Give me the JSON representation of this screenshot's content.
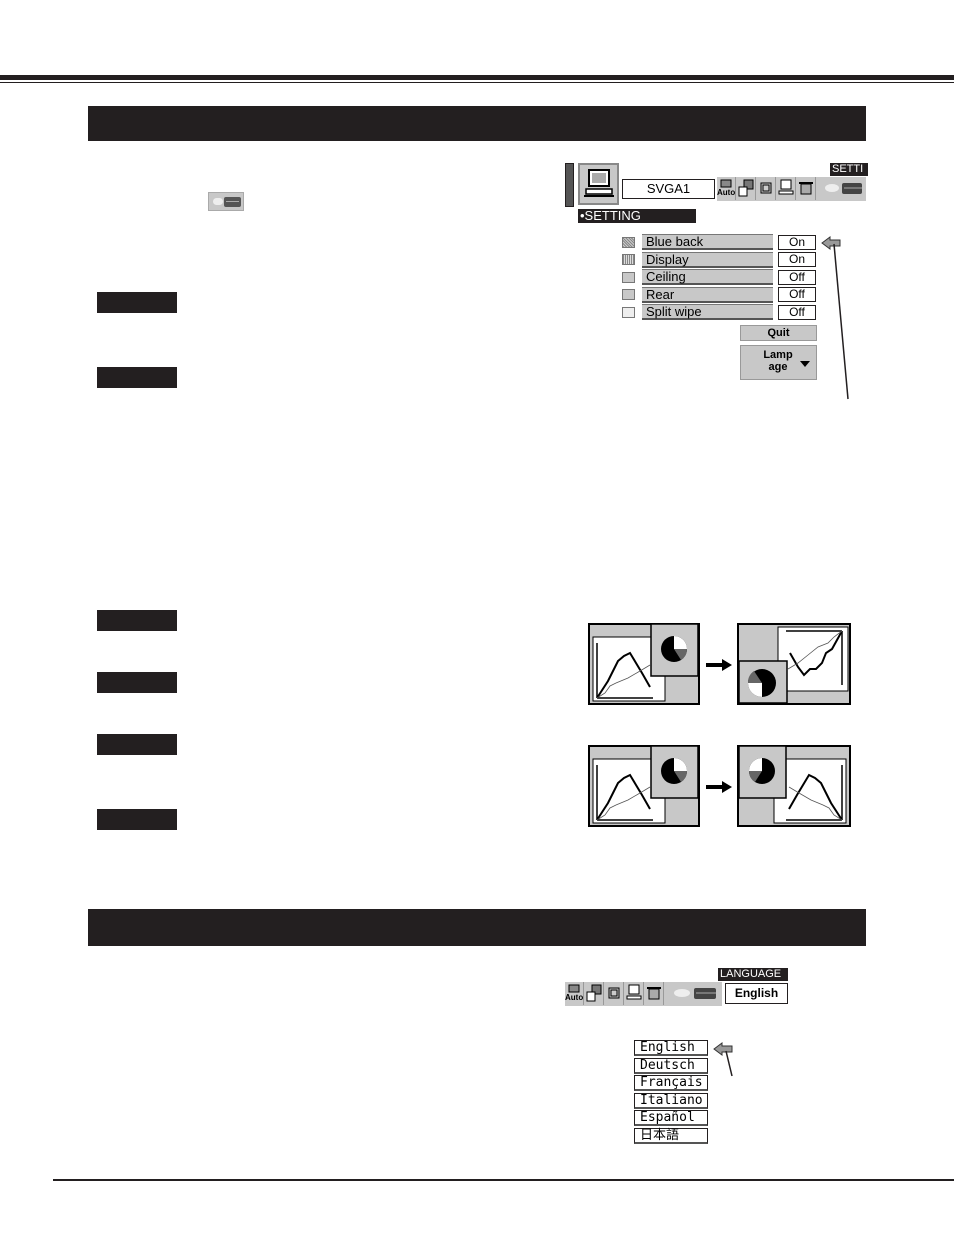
{
  "page": {
    "section_headers": [
      "",
      ""
    ],
    "labels": [
      "",
      "",
      "",
      "",
      "",
      ""
    ]
  },
  "setting_menu": {
    "source_field": "SVGA1",
    "toolbar_title": "SETTI",
    "toolbar_buttons": [
      {
        "icon": "auto-pc-adjust-icon",
        "label": "Auto"
      },
      {
        "icon": "image-select-icon",
        "label": ""
      },
      {
        "icon": "screen-position-icon",
        "label": ""
      },
      {
        "icon": "pc-system-icon",
        "label": ""
      },
      {
        "icon": "screen-icon",
        "label": ""
      },
      {
        "icon": "setting-lamp-icon",
        "label": ""
      }
    ],
    "section_label": "•SETTING",
    "items": [
      {
        "icon": "blue-back-icon",
        "label": "Blue back",
        "value": "On"
      },
      {
        "icon": "display-icon",
        "label": "Display",
        "value": "On"
      },
      {
        "icon": "ceiling-icon",
        "label": "Ceiling",
        "value": "Off"
      },
      {
        "icon": "rear-icon",
        "label": "Rear",
        "value": "Off"
      },
      {
        "icon": "split-wipe-icon",
        "label": "Split wipe",
        "value": "Off"
      }
    ],
    "quit_label": "Quit",
    "lamp_age_label": "Lamp age",
    "lamp_age_line1": "Lamp",
    "lamp_age_line2": "age",
    "pointer": "arrow-pointer-icon"
  },
  "diagrams": {
    "ceiling": {
      "caption": "",
      "description": "Image flipped vertically"
    },
    "rear": {
      "caption": "",
      "description": "Image flipped horizontally"
    }
  },
  "language_menu": {
    "toolbar_title": "LANGUAGE",
    "current": "English",
    "toolbar_buttons": [
      {
        "icon": "auto-pc-adjust-icon",
        "label": "Auto"
      },
      {
        "icon": "image-select-icon",
        "label": ""
      },
      {
        "icon": "screen-position-icon",
        "label": ""
      },
      {
        "icon": "pc-system-icon",
        "label": ""
      },
      {
        "icon": "screen-icon",
        "label": ""
      },
      {
        "icon": "setting-lamp-icon",
        "label": ""
      }
    ],
    "options": [
      "English",
      "Deutsch",
      "Français",
      "Italiano",
      "Español",
      "日本語"
    ],
    "selected_index": 0
  }
}
